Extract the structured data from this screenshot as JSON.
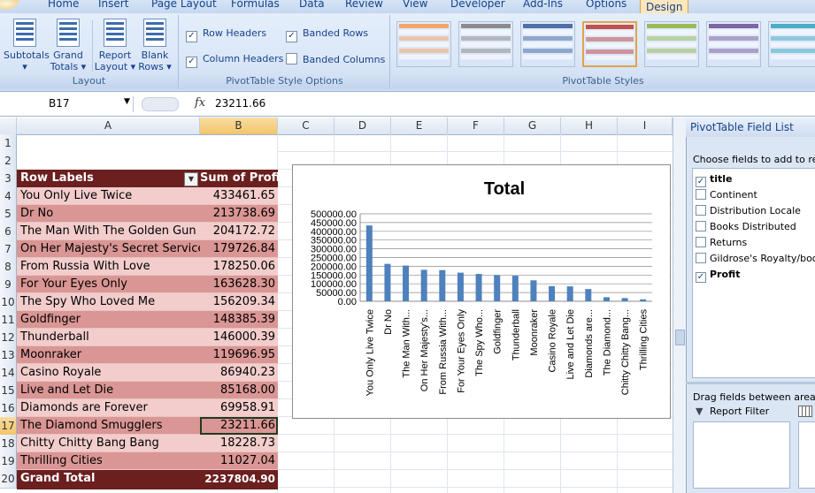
{
  "ribbon_tabs": [
    "Home",
    "Insert",
    "Page Layout",
    "Formulas",
    "Data",
    "Review",
    "View",
    "Developer",
    "Add-Ins",
    "Options",
    "Design"
  ],
  "active_tab": "Design",
  "layout_group": {
    "label": "Layout",
    "buttons": [
      {
        "line1": "Subtotals",
        "line2": "▾"
      },
      {
        "line1": "Grand",
        "line2": "Totals ▾"
      },
      {
        "line1": "Report",
        "line2": "Layout ▾"
      },
      {
        "line1": "Blank",
        "line2": "Rows ▾"
      }
    ]
  },
  "style_options": {
    "label": "PivotTable Style Options",
    "row_headers": "Row Headers",
    "column_headers": "Column Headers",
    "banded_rows": "Banded Rows",
    "banded_columns": "Banded Columns",
    "checked": {
      "row_headers": true,
      "column_headers": true,
      "banded_rows": true,
      "banded_columns": false
    }
  },
  "styles_group": {
    "label": "PivotTable Styles",
    "swatch_colors": [
      "#f5a46b",
      "#8c8c8c",
      "#4f6fa8",
      "#c0504d",
      "#9bbb59",
      "#8064a2",
      "#4bacc6"
    ]
  },
  "formula_bar": {
    "cell_ref": "B17",
    "fx": "fx",
    "value": "23211.66"
  },
  "columns": [
    "A",
    "B",
    "C",
    "D",
    "E",
    "F",
    "G",
    "H",
    "I"
  ],
  "selected_column": "B",
  "selected_row": "17",
  "rows": [
    "1",
    "2",
    "3",
    "4",
    "5",
    "6",
    "7",
    "8",
    "9",
    "10",
    "11",
    "12",
    "13",
    "14",
    "15",
    "16",
    "17",
    "18",
    "19",
    "20"
  ],
  "pivot": {
    "header_a": "Row Labels",
    "header_b": "Sum of Profit",
    "filter_icon": "dropdown-filter-icon",
    "items": [
      {
        "label": "You Only Live Twice",
        "value": "433461.65"
      },
      {
        "label": "Dr No",
        "value": "213738.69"
      },
      {
        "label": "The Man With The Golden Gun",
        "value": "204172.72"
      },
      {
        "label": "On Her Majesty's Secret Service",
        "value": "179726.84"
      },
      {
        "label": "From Russia With Love",
        "value": "178250.06"
      },
      {
        "label": "For Your Eyes Only",
        "value": "163628.30"
      },
      {
        "label": "The Spy Who Loved Me",
        "value": "156209.34"
      },
      {
        "label": "Goldfinger",
        "value": "148385.39"
      },
      {
        "label": "Thunderball",
        "value": "146000.39"
      },
      {
        "label": "Moonraker",
        "value": "119696.95"
      },
      {
        "label": "Casino Royale",
        "value": "86940.23"
      },
      {
        "label": "Live and Let Die",
        "value": "85168.00"
      },
      {
        "label": "Diamonds are Forever",
        "value": "69958.91"
      },
      {
        "label": "The Diamond Smugglers",
        "value": "23211.66"
      },
      {
        "label": "Chitty Chitty Bang Bang",
        "value": "18228.73"
      },
      {
        "label": "Thrilling Cities",
        "value": "11027.04"
      }
    ],
    "grand_total_label": "Grand Total",
    "grand_total_value": "2237804.90",
    "colors": {
      "header": "#6b1f1f",
      "band_dark": "#da9694",
      "band_light": "#f2cdcc"
    }
  },
  "chart_data": {
    "type": "bar",
    "title": "Total",
    "categories": [
      "You Only Live Twice",
      "Dr No",
      "The Man With...",
      "On Her Majesty's...",
      "From Russia With...",
      "For Your Eyes Only",
      "The Spy Who...",
      "Goldfinger",
      "Thunderball",
      "Moonraker",
      "Casino Royale",
      "Live and Let Die",
      "Diamonds are...",
      "The Diamond...",
      "Chitty Chitty Bang...",
      "Thrilling Cities"
    ],
    "values": [
      433461.65,
      213738.69,
      204172.72,
      179726.84,
      178250.06,
      163628.3,
      156209.34,
      148385.39,
      146000.39,
      119696.95,
      86940.23,
      85168.0,
      69958.91,
      23211.66,
      18228.73,
      11027.04
    ],
    "yticks": [
      "0.00",
      "50000.00",
      "100000.00",
      "150000.00",
      "200000.00",
      "250000.00",
      "300000.00",
      "350000.00",
      "400000.00",
      "450000.00",
      "500000.00"
    ],
    "ylim": [
      0,
      500000
    ],
    "grid": true,
    "bar_color": "#4f81bd"
  },
  "field_list": {
    "title": "PivotTable Field List",
    "prompt": "Choose fields to add to report:",
    "fields": [
      {
        "name": "title",
        "checked": true,
        "bold": true
      },
      {
        "name": "Continent",
        "checked": false,
        "bold": false
      },
      {
        "name": "Distribution Locale",
        "checked": false,
        "bold": false
      },
      {
        "name": "Books Distributed",
        "checked": false,
        "bold": false
      },
      {
        "name": "Returns",
        "checked": false,
        "bold": false
      },
      {
        "name": "Gildrose's Royalty/book",
        "checked": false,
        "bold": false
      },
      {
        "name": "Profit",
        "checked": true,
        "bold": true
      }
    ],
    "drag_label": "Drag fields between areas below:",
    "report_filter": "Report Filter"
  }
}
